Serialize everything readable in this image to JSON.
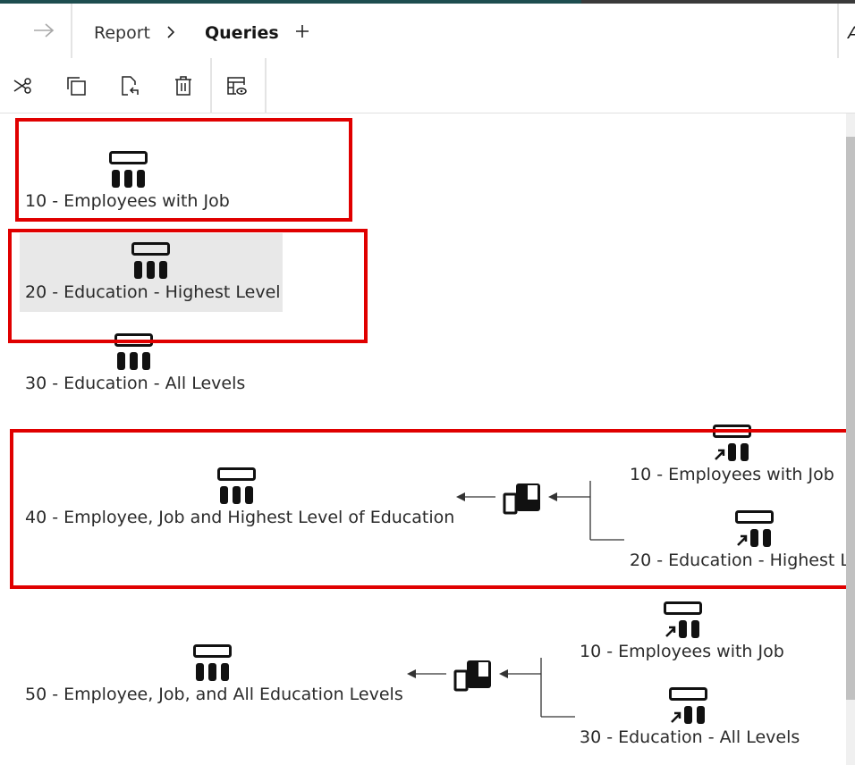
{
  "header": {
    "back_icon": "arrow-right-icon",
    "breadcrumb": [
      "Report",
      "Queries"
    ],
    "add_icon": "plus-icon",
    "cut_off_text": "A"
  },
  "toolbar": {
    "icons": [
      "scissors-icon",
      "copy-icon",
      "paste-icon",
      "trash-icon",
      "table-preview-icon"
    ]
  },
  "colors": {
    "top_accent": "#1d4d4f",
    "highlight": "#e00000",
    "selection": "#e8e8e8"
  },
  "queries": [
    {
      "label": "10 - Employees with Job"
    },
    {
      "label": "20 - Education - Highest Level"
    },
    {
      "label": "30 - Education - All Levels"
    },
    {
      "label": "40 - Employee, Job and Highest Level of Education",
      "sources": [
        "10 - Employees with Job",
        "20 - Education - Highest L"
      ]
    },
    {
      "label": "50 - Employee, Job, and All Education Levels",
      "sources": [
        "10 - Employees with Job",
        "30 - Education - All Levels"
      ]
    }
  ]
}
